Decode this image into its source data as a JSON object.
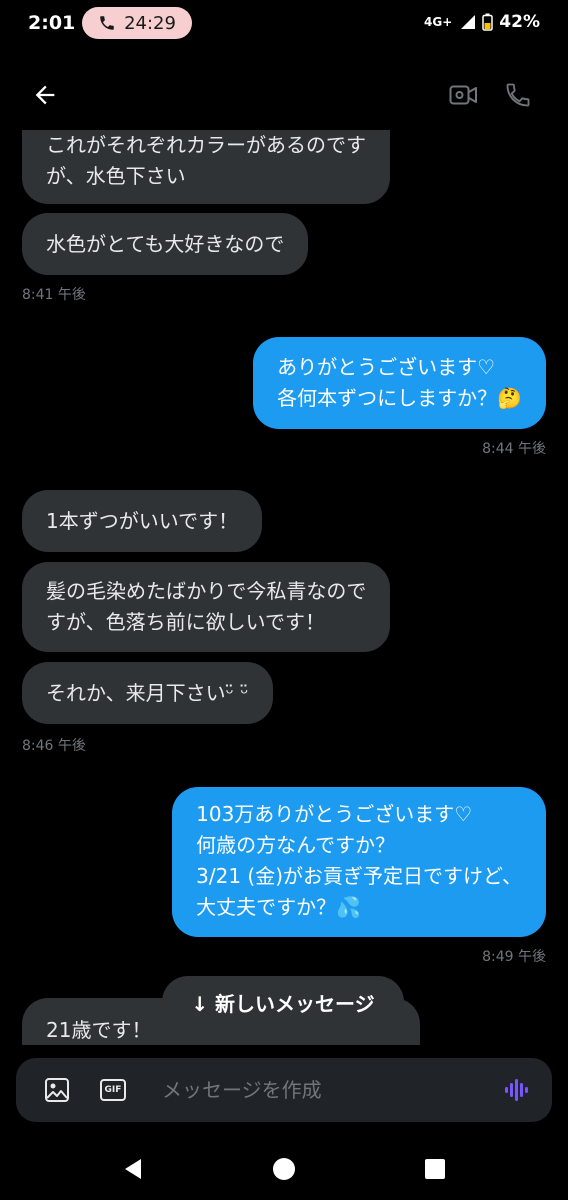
{
  "status": {
    "time": "2:01",
    "call_timer": "24:29",
    "network": "4G+",
    "battery": "42%"
  },
  "messages": [
    {
      "dir": "in",
      "text": "これがそれぞれカラーがあるのです\nが、水色下さい"
    },
    {
      "dir": "in",
      "text": "水色がとても大好きなので"
    },
    {
      "dir": "time",
      "text": "8:41 午後"
    },
    {
      "dir": "out",
      "text": "ありがとうございます♡\n各何本ずつにしますか？🤔"
    },
    {
      "dir": "time",
      "text": "8:44 午後"
    },
    {
      "dir": "in",
      "text": "1本ずつがいいです！"
    },
    {
      "dir": "in",
      "text": "髪の毛染めたばかりで今私青なので\nすが、色落ち前に欲しいです！"
    },
    {
      "dir": "in",
      "text": "それか、来月下さいᵕ̈ ᵕ̈"
    },
    {
      "dir": "time",
      "text": "8:46 午後"
    },
    {
      "dir": "out",
      "text": "103万ありがとうございます♡\n何歳の方なんですか？\n3/21 (金)がお貢ぎ予定日ですけど、\n大丈夫ですか？💦"
    },
    {
      "dir": "time",
      "text": "8:49 午後"
    },
    {
      "dir": "in",
      "text": "21歳です！"
    }
  ],
  "new_message_pill": "↓ 新しいメッセージ",
  "composer": {
    "placeholder": "メッセージを作成",
    "gif_label": "GIF"
  },
  "colors": {
    "incoming": "#2f3336",
    "outgoing": "#1d9bf0",
    "accent": "#7856ff"
  }
}
